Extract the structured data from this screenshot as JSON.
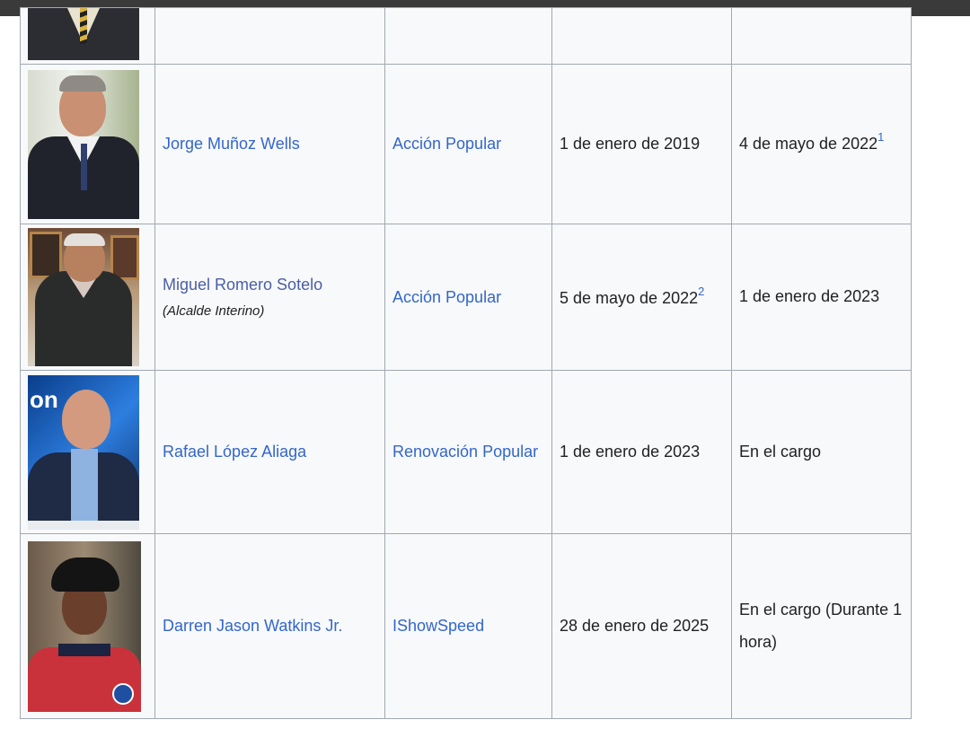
{
  "rows": [
    {
      "name": "",
      "party": "",
      "start": "",
      "end": "",
      "photo_icon": "portrait-photo"
    },
    {
      "name": "Jorge Muñoz Wells",
      "party": "Acción Popular",
      "start": "1 de enero de 2019",
      "end": "4 de mayo de 2022",
      "end_ref": "1",
      "photo_icon": "portrait-photo"
    },
    {
      "name": "Miguel Romero Sotelo",
      "name_note": "(Alcalde Interino)",
      "party": "Acción Popular",
      "start": "5 de mayo de 2022",
      "start_ref": "2",
      "end": "1 de enero de 2023",
      "photo_icon": "portrait-photo"
    },
    {
      "name": "Rafael López Aliaga",
      "party": "Renovación Popular",
      "start": "1 de enero de 2023",
      "end": "En el cargo",
      "photo_icon": "portrait-photo"
    },
    {
      "name": "Darren Jason Watkins Jr.",
      "party": "IShowSpeed",
      "start": "28 de enero de 2025",
      "end": "En el cargo (Durante 1 hora)",
      "photo_icon": "portrait-photo"
    }
  ],
  "colors": {
    "link": "#3366cc",
    "cell_bg": "#f8f9fa",
    "border": "#a2a9b1",
    "topbar": "#3a3a3a"
  }
}
